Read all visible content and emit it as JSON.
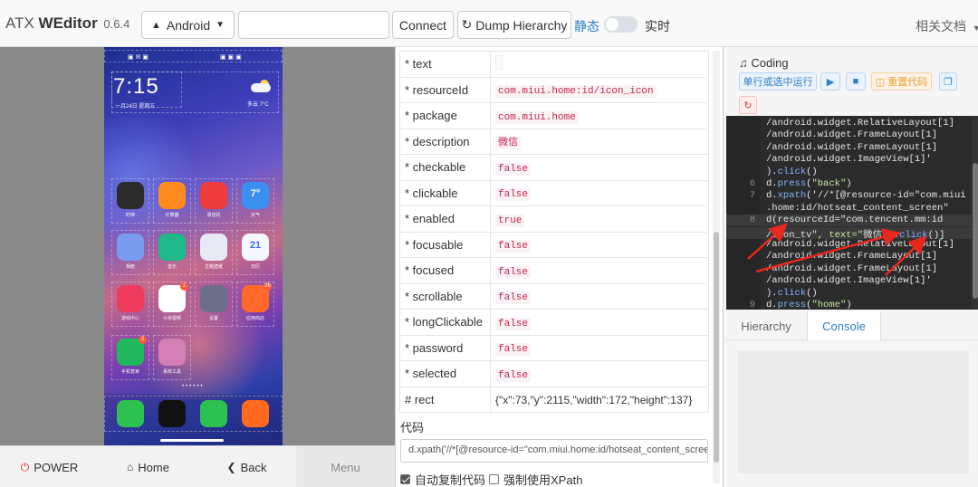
{
  "navbar": {
    "brand_prefix": "ATX ",
    "brand_name": "WEditor",
    "version": "0.6.4",
    "platform_icon": "android-icon",
    "platform": "Android",
    "serial_value": "",
    "connect_label": "Connect",
    "dump_icon": "refresh-icon",
    "dump_label": "Dump Hierarchy",
    "static_label": "静态",
    "realtime_label": "实时",
    "realtime_enabled": false,
    "docs_label": "相关文档"
  },
  "phone": {
    "status_left": "▣ ✉ ▣",
    "status_right": "▣ ▣ ▣",
    "clock": "7:15",
    "clock_sub": "一月24日 星期五",
    "weather_sub": "多云 7°C",
    "apps": [
      {
        "label": "时钟",
        "color": "#2b2b2b"
      },
      {
        "label": "计算器",
        "color": "#ff8a1f"
      },
      {
        "label": "录音机",
        "color": "#ee3b3b"
      },
      {
        "label": "天气",
        "color": "#3b8ff0",
        "glyph": "7°"
      },
      {
        "label": "相册",
        "color": "#7a9cf0"
      },
      {
        "label": "音乐",
        "color": "#1fb889"
      },
      {
        "label": "主题壁纸",
        "color": "#e9e9f5"
      },
      {
        "label": "日历",
        "color": "#f5f7ff",
        "glyph": "21"
      },
      {
        "label": "游戏中心",
        "color": "#ee3b5e"
      },
      {
        "label": "小米视频",
        "color": "#ffffff",
        "badge": "1"
      },
      {
        "label": "设置",
        "color": "#6b6f8a"
      },
      {
        "label": "应用商店",
        "color": "#ff6a2b",
        "badge": "26"
      },
      {
        "label": "手机管家",
        "color": "#1fb85a",
        "badge": "2"
      },
      {
        "label": "系统工具",
        "color": "#d47fb5"
      }
    ],
    "dock": [
      {
        "color": "#2dc150"
      },
      {
        "color": "#111111"
      },
      {
        "color": "#2dc150"
      },
      {
        "color": "#ff6a1f"
      }
    ]
  },
  "phone_footer": {
    "power": "POWER",
    "home": "Home",
    "back": "Back",
    "menu": "Menu"
  },
  "properties": [
    {
      "key": "* text",
      "value": "",
      "kind": "empty"
    },
    {
      "key": "* resourceId",
      "value": "com.miui.home:id/icon_icon",
      "kind": "code"
    },
    {
      "key": "* package",
      "value": "com.miui.home",
      "kind": "code"
    },
    {
      "key": "* description",
      "value": "微信",
      "kind": "code"
    },
    {
      "key": "* checkable",
      "value": "false",
      "kind": "code"
    },
    {
      "key": "* clickable",
      "value": "false",
      "kind": "code"
    },
    {
      "key": "* enabled",
      "value": "true",
      "kind": "code"
    },
    {
      "key": "* focusable",
      "value": "false",
      "kind": "code"
    },
    {
      "key": "* focused",
      "value": "false",
      "kind": "code"
    },
    {
      "key": "* scrollable",
      "value": "false",
      "kind": "code"
    },
    {
      "key": "* longClickable",
      "value": "false",
      "kind": "code"
    },
    {
      "key": "* password",
      "value": "false",
      "kind": "code"
    },
    {
      "key": "* selected",
      "value": "false",
      "kind": "code"
    },
    {
      "key": "# rect",
      "value": "{\"x\":73,\"y\":2115,\"width\":172,\"height\":137}",
      "kind": "plain"
    }
  ],
  "code_panel": {
    "label": "代码",
    "value": "d.xpath('//*[@resource-id=\"com.miui.home:id/hotseat_content_scree",
    "auto_copy_label": "自动复制代码",
    "auto_copy_checked": true,
    "force_xpath_label": "强制使用XPath",
    "force_xpath_checked": false
  },
  "coding": {
    "title": "Coding",
    "run_selected_label": "单行或选中运行",
    "reset_label": "重置代码",
    "lines": [
      {
        "ln": "",
        "text": "    /android.widget.RelativeLayout[1]"
      },
      {
        "ln": "",
        "text": "    /android.widget.FrameLayout[1]"
      },
      {
        "ln": "",
        "text": "    /android.widget.FrameLayout[1]"
      },
      {
        "ln": "",
        "text": "    /android.widget.ImageView[1]'"
      },
      {
        "ln": "",
        "text": "    ).click()"
      },
      {
        "ln": "6",
        "text": "d.press(\"back\")"
      },
      {
        "ln": "7",
        "text": "d.xpath('//*[@resource-id=\"com.miui"
      },
      {
        "ln": "",
        "text": "    .home:id/hotseat_content_screen\""
      },
      {
        "ln": "8",
        "text": "d(resourceId=\"com.tencent.mm:id"
      },
      {
        "ln": "",
        "text": "    /icon_tv\", text=\"微信\").click()]"
      },
      {
        "ln": "",
        "text": "    /android.widget.RelativeLayout[1]"
      },
      {
        "ln": "",
        "text": "    /android.widget.FrameLayout[1]"
      },
      {
        "ln": "",
        "text": "    /android.widget.FrameLayout[1]"
      },
      {
        "ln": "",
        "text": "    /android.widget.ImageView[1]'"
      },
      {
        "ln": "",
        "text": "    ).click()"
      },
      {
        "ln": "9",
        "text": "d.press(\"home\")"
      }
    ],
    "tabs": [
      "Hierarchy",
      "Console"
    ],
    "active_tab": "Console",
    "annotation_color": "#e8281f"
  }
}
